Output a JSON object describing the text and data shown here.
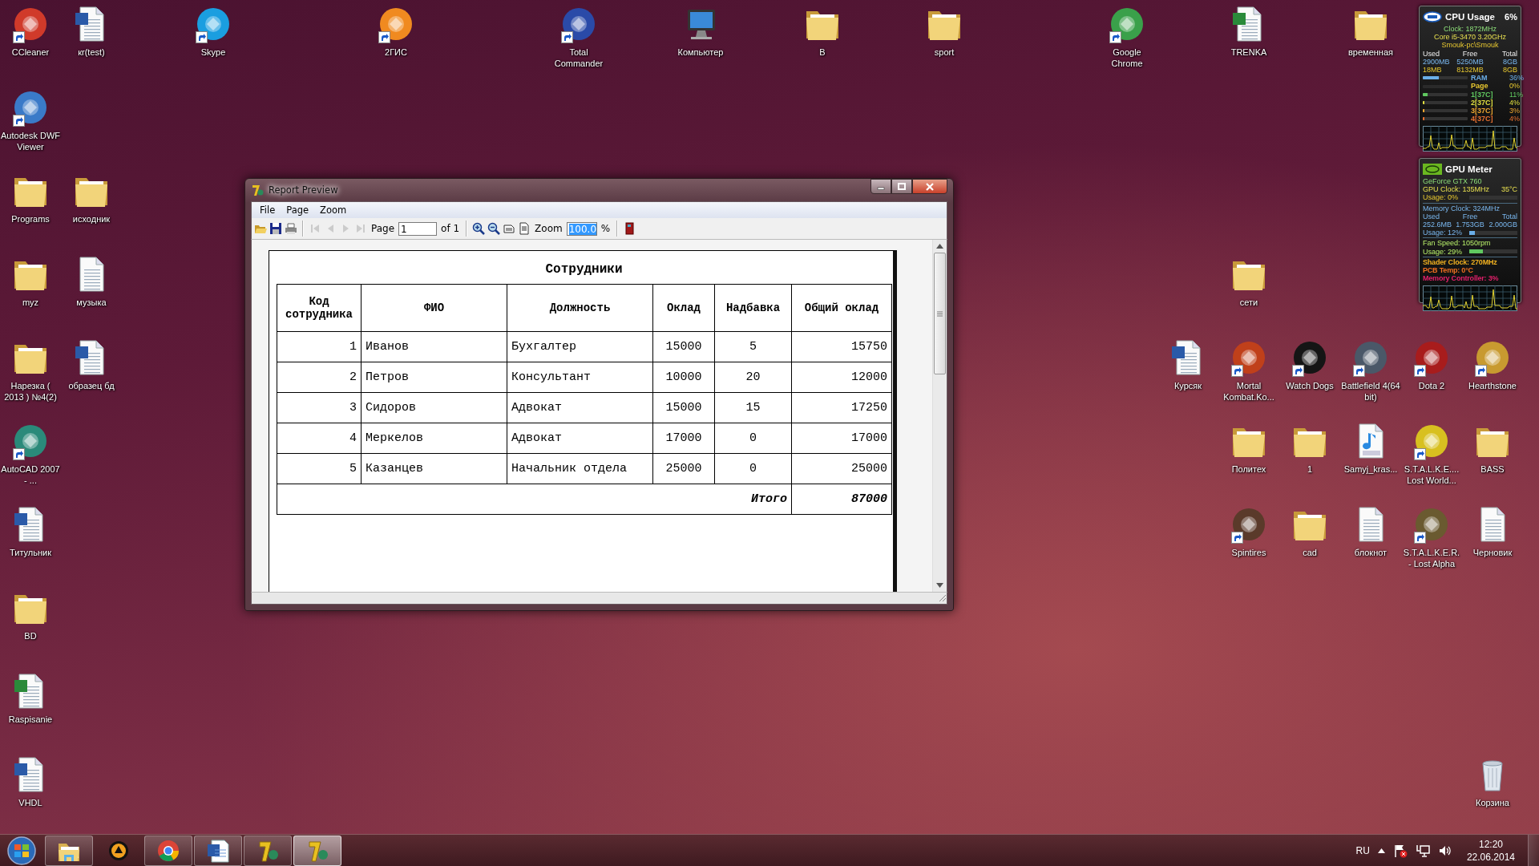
{
  "desktop": {
    "icons": [
      {
        "label": "CCleaner",
        "kind": "app",
        "color": "#d03a2a",
        "shortcut": true
      },
      {
        "label": "кr(test)",
        "kind": "word",
        "shortcut": false
      },
      {
        "label": "Skype",
        "kind": "app",
        "color": "#1a9ee0",
        "shortcut": true
      },
      {
        "label": "2ГИС",
        "kind": "app",
        "color": "#f08a20",
        "shortcut": true
      },
      {
        "label": "Total Commander",
        "kind": "app",
        "color": "#2a4aa8",
        "shortcut": true
      },
      {
        "label": "Компьютер",
        "kind": "computer",
        "shortcut": false
      },
      {
        "label": "B",
        "kind": "folder",
        "shortcut": false
      },
      {
        "label": "sport",
        "kind": "folder",
        "shortcut": false
      },
      {
        "label": "Google Chrome",
        "kind": "app",
        "color": "#3aa04a",
        "shortcut": true
      },
      {
        "label": "TRENKA",
        "kind": "excel",
        "shortcut": false
      },
      {
        "label": "временная",
        "kind": "folder",
        "shortcut": false
      },
      {
        "label": "Autodesk DWF Viewer",
        "kind": "app",
        "color": "#3a7ac8",
        "shortcut": true
      },
      {
        "label": "Programs",
        "kind": "folder",
        "shortcut": false
      },
      {
        "label": "исходник",
        "kind": "folder",
        "shortcut": false
      },
      {
        "label": "myz",
        "kind": "folder",
        "shortcut": false
      },
      {
        "label": "музыка",
        "kind": "document",
        "shortcut": false
      },
      {
        "label": "сети",
        "kind": "folder",
        "shortcut": false
      },
      {
        "label": "Нарезка ( 2013 ) №4(2)",
        "kind": "folder",
        "shortcut": false
      },
      {
        "label": "образец бд",
        "kind": "word",
        "shortcut": false
      },
      {
        "label": "Курсяк",
        "kind": "word",
        "shortcut": false
      },
      {
        "label": "Mortal Kombat.Ko...",
        "kind": "app",
        "color": "#c0401a",
        "shortcut": true
      },
      {
        "label": "Watch Dogs",
        "kind": "app",
        "color": "#151515",
        "shortcut": true
      },
      {
        "label": "Battlefield 4(64 bit)",
        "kind": "app",
        "color": "#4a5868",
        "shortcut": true
      },
      {
        "label": "Dota 2",
        "kind": "app",
        "color": "#a81c1c",
        "shortcut": true
      },
      {
        "label": "Hearthstone",
        "kind": "app",
        "color": "#c89a30",
        "shortcut": true
      },
      {
        "label": "AutoCAD 2007 - ...",
        "kind": "app",
        "color": "#2a8a7a",
        "shortcut": true
      },
      {
        "label": "Политех",
        "kind": "folder",
        "shortcut": false
      },
      {
        "label": "1",
        "kind": "folder",
        "shortcut": false
      },
      {
        "label": "Samyj_kras...",
        "kind": "mp3",
        "shortcut": false
      },
      {
        "label": "S.T.A.L.K.E.... Lost World...",
        "kind": "app",
        "color": "#d8c020",
        "shortcut": true
      },
      {
        "label": "BASS",
        "kind": "folder",
        "shortcut": false
      },
      {
        "label": "Титульник",
        "kind": "word",
        "shortcut": false
      },
      {
        "label": "Spintires",
        "kind": "app",
        "color": "#5a3a2a",
        "shortcut": true
      },
      {
        "label": "cad",
        "kind": "folder",
        "shortcut": false
      },
      {
        "label": "блокнот",
        "kind": "document",
        "shortcut": false
      },
      {
        "label": "S.T.A.L.K.E.R. - Lost Alpha",
        "kind": "app",
        "color": "#6a5a30",
        "shortcut": true
      },
      {
        "label": "Черновик",
        "kind": "document",
        "shortcut": false
      },
      {
        "label": "BD",
        "kind": "folder",
        "shortcut": false
      },
      {
        "label": "Raspisanie",
        "kind": "excel",
        "shortcut": false
      },
      {
        "label": "VHDL",
        "kind": "word",
        "shortcut": false
      },
      {
        "label": "Корзина",
        "kind": "recycle",
        "shortcut": false
      }
    ]
  },
  "cpu_meter": {
    "title": "CPU Usage",
    "usage": "6%",
    "clock": "Clock: 1872MHz",
    "model": "Core i5-3470 3.20GHz",
    "user": "Smouk-pc\\Smouk",
    "memory_columns": [
      "Used",
      "Free",
      "Total"
    ],
    "memory_rows": [
      [
        "2900MB",
        "5250MB",
        "8GB"
      ],
      [
        "18MB",
        "8132MB",
        "8GB"
      ]
    ],
    "meters": [
      {
        "label": "RAM",
        "value": "36%",
        "level": 0.36,
        "color": "#6aaee8"
      },
      {
        "label": "Page",
        "value": "0%",
        "level": 0,
        "color": "#e8c830"
      },
      {
        "label": "1[37C]",
        "value": "11%",
        "level": 0.11,
        "color": "#60c860"
      },
      {
        "label": "2[37C]",
        "value": "4%",
        "level": 0.04,
        "color": "#e0e040"
      },
      {
        "label": "3[37C]",
        "value": "3%",
        "level": 0.03,
        "color": "#f0a830"
      },
      {
        "label": "4[37C]",
        "value": "4%",
        "level": 0.04,
        "color": "#e87030"
      }
    ]
  },
  "gpu_meter": {
    "title": "GPU Meter",
    "model": "GeForce GTX 760",
    "core": {
      "clock": "GPU Clock: 135MHz",
      "temperature": "35°C",
      "usage": "Usage: 0%",
      "level": 0
    },
    "memory": {
      "clock": "Memory Clock: 324MHz",
      "columns": [
        "Used",
        "Free",
        "Total"
      ],
      "values": [
        "252.6MB",
        "1.753GB",
        "2.000GB"
      ],
      "usage": "Usage: 12%",
      "level": 0.12
    },
    "fan": {
      "speed": "Fan Speed: 1050rpm",
      "usage": "Usage: 29%",
      "level": 0.29
    },
    "footer": [
      {
        "text": "Shader Clock: 270MHz",
        "color": "#f0b020"
      },
      {
        "text": "PCB Temp: 0°C",
        "color": "#f07020"
      },
      {
        "text": "Memory Controller: 3%",
        "color": "#e0206a"
      }
    ]
  },
  "report_window": {
    "title": "Report Preview",
    "menu": [
      "File",
      "Page",
      "Zoom"
    ],
    "toolbar": [
      [
        {
          "kind": "open",
          "disabled": false
        },
        {
          "kind": "save",
          "disabled": false
        },
        {
          "kind": "print",
          "disabled": false
        }
      ],
      [
        {
          "kind": "first",
          "disabled": true
        },
        {
          "kind": "previous",
          "disabled": true
        },
        {
          "kind": "next",
          "disabled": true
        },
        {
          "kind": "last",
          "disabled": true
        },
        {
          "kind": "page_field",
          "label": "Page",
          "value": "1",
          "suffix": "of 1"
        }
      ],
      [
        {
          "kind": "zoom_in",
          "disabled": false
        },
        {
          "kind": "zoom_out",
          "disabled": false
        },
        {
          "kind": "page_width",
          "disabled": false
        },
        {
          "kind": "whole_page",
          "disabled": false
        },
        {
          "kind": "zoom_field",
          "label": "Zoom",
          "value": "100.0",
          "selected": true,
          "suffix": "%"
        }
      ],
      [
        {
          "kind": "exit",
          "disabled": false
        }
      ]
    ],
    "report": {
      "title": "Сотрудники",
      "columns": [
        "Код сотрудника",
        "ФИО",
        "Должность",
        "Оклад",
        "Надбавка",
        "Общий оклад"
      ],
      "rows": [
        [
          "1",
          "Иванов",
          "Бухгалтер",
          "15000",
          "5",
          "15750"
        ],
        [
          "2",
          "Петров",
          "Консультант",
          "10000",
          "20",
          "12000"
        ],
        [
          "3",
          "Сидоров",
          "Адвокат",
          "15000",
          "15",
          "17250"
        ],
        [
          "4",
          "Меркелов",
          "Адвокат",
          "17000",
          "0",
          "17000"
        ],
        [
          "5",
          "Казанцев",
          "Начальник отдела",
          "25000",
          "0",
          "25000"
        ]
      ],
      "total_label": "Итого",
      "total": "87000"
    }
  },
  "taskbar": {
    "buttons": [
      {
        "kind": "explorer",
        "running": true,
        "active": false
      },
      {
        "kind": "player",
        "running": false,
        "active": false
      },
      {
        "kind": "chrome",
        "running": true,
        "active": false
      },
      {
        "kind": "word",
        "running": true,
        "active": false
      },
      {
        "kind": "report_app",
        "running": true,
        "active": false
      },
      {
        "kind": "report_app",
        "running": true,
        "active": true
      }
    ],
    "language": "RU",
    "time": "12:20",
    "date": "22.06.2014"
  }
}
